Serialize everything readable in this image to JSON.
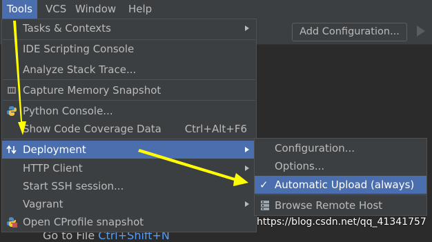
{
  "menubar": [
    "Tools",
    "VCS",
    "Window",
    "Help"
  ],
  "toolbar": {
    "add_config": "Add Configuration..."
  },
  "tools_menu": {
    "items": [
      {
        "label": "Tasks & Contexts",
        "submenu": true
      },
      {
        "label": "IDE Scripting Console"
      },
      {
        "label": "Analyze Stack Trace..."
      },
      {
        "label": "Capture Memory Snapshot"
      },
      {
        "label": "Python Console..."
      },
      {
        "label": "Show Code Coverage Data",
        "shortcut": "Ctrl+Alt+F6"
      },
      {
        "label": "Deployment",
        "submenu": true
      },
      {
        "label": "HTTP Client",
        "submenu": true
      },
      {
        "label": "Start SSH session..."
      },
      {
        "label": "Vagrant",
        "submenu": true
      },
      {
        "label": "Open CProfile snapshot"
      }
    ]
  },
  "deployment_submenu": {
    "items": [
      {
        "label": "Configuration..."
      },
      {
        "label": "Options..."
      },
      {
        "label": "Automatic Upload (always)",
        "checked": true
      },
      {
        "label": "Browse Remote Host"
      }
    ]
  },
  "background_hint": {
    "text": "Go to File ",
    "shortcut": "Ctrl+Shift+N"
  },
  "watermark": "https://blog.csdn.net/qq_41341757",
  "colors": {
    "selection": "#4b6eaf",
    "annotation_arrow": "#ffff00"
  }
}
